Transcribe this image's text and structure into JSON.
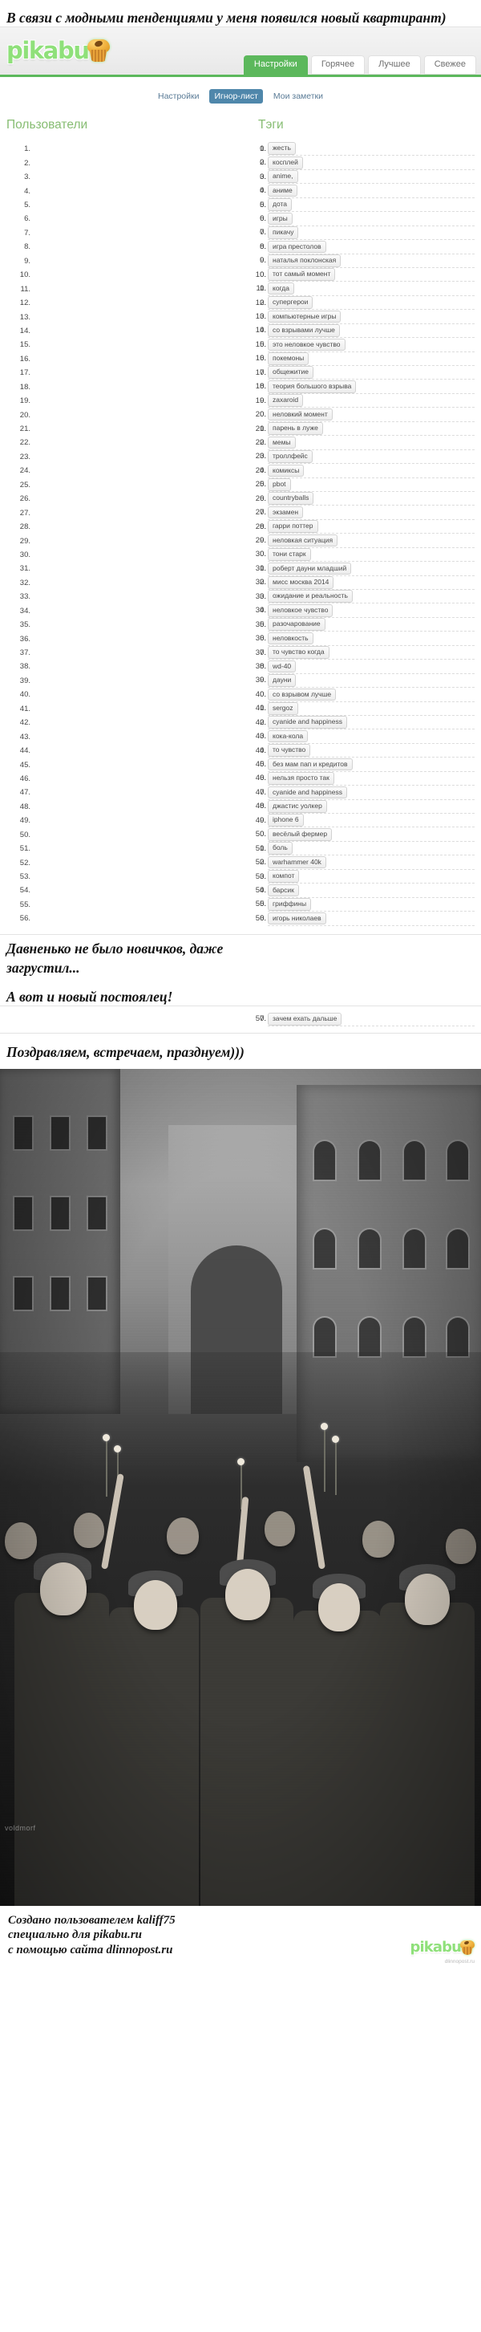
{
  "captions": {
    "top": "В связи с модными тенденциями у меня появился новый квартирант)",
    "mid_1": "Давненько не было новичков, даже",
    "mid_2": "загрустил...",
    "mid_3": "А вот и новый постоялец!",
    "mid_4": "Поздравляем, встречаем, празднуем)))"
  },
  "site": {
    "logo_text": "pikabu",
    "logo_icon": "muffin-icon",
    "tabs": [
      {
        "label": "Настройки",
        "active": true
      },
      {
        "label": "Горячее",
        "active": false
      },
      {
        "label": "Лучшее",
        "active": false
      },
      {
        "label": "Свежее",
        "active": false
      }
    ],
    "subnav": [
      {
        "label": "Настройки",
        "active": false
      },
      {
        "label": "Игнор-лист",
        "active": true
      },
      {
        "label": "Мои заметки",
        "active": false
      }
    ],
    "columns": {
      "users_heading": "Пользователи",
      "tags_heading": "Тэги"
    },
    "users": [],
    "tags": [
      "жесть",
      "косплей",
      "anime,",
      "аниме",
      "дота",
      "игры",
      "пикачу",
      "игра престолов",
      "наталья поклонская",
      "тот самый момент",
      "когда",
      "супергерои",
      "компьютерные игры",
      "со взрывами лучше",
      "это неловкое чувство",
      "покемоны",
      "общежитие",
      "теория большого взрыва",
      "zaxaroid",
      "неловкий момент",
      "парень в луже",
      "мемы",
      "троллфейс",
      "комиксы",
      "pbot",
      "countryballs",
      "экзамен",
      "гарри поттер",
      "неловкая ситуация",
      "тони старк",
      "роберт дауни младший",
      "мисс москва 2014",
      "ожидание и реальность",
      "неловкое чувство",
      "разочарование",
      "неловкость",
      "то чувство когда",
      "wd-40",
      "дауни",
      "со взрывом лучше",
      "sergoz",
      "cyanide and happiness",
      "кока-кола",
      "то чувство",
      "без мам пап и кредитов",
      "нельзя просто так",
      "cyanide and happiness",
      "джастис уолкер",
      "iphone 6",
      "весёлый фермер",
      "боль",
      "warhammer 40k",
      "компот",
      "барсик",
      "гриффины",
      "игорь николаев",
      "зачем ехать дальше"
    ],
    "tags_split_at": 56
  },
  "photo": {
    "alt_name": "victory-day-soldiers-photo",
    "watermark": "voldmorf"
  },
  "footer": {
    "line_1": "Создано пользователем kaliff75",
    "line_2": "специально для pikabu.ru",
    "line_3": "с помощью сайта dlinnopost.ru",
    "logo_text": "pikabu",
    "credit": "dlinnopost.ru"
  },
  "colors": {
    "brand_green": "#5cb85c",
    "logo_green": "#8fe07a",
    "heading_green": "#87bd73",
    "subnav_blue": "#4f87ab",
    "tag_border": "#d2d2d2"
  }
}
